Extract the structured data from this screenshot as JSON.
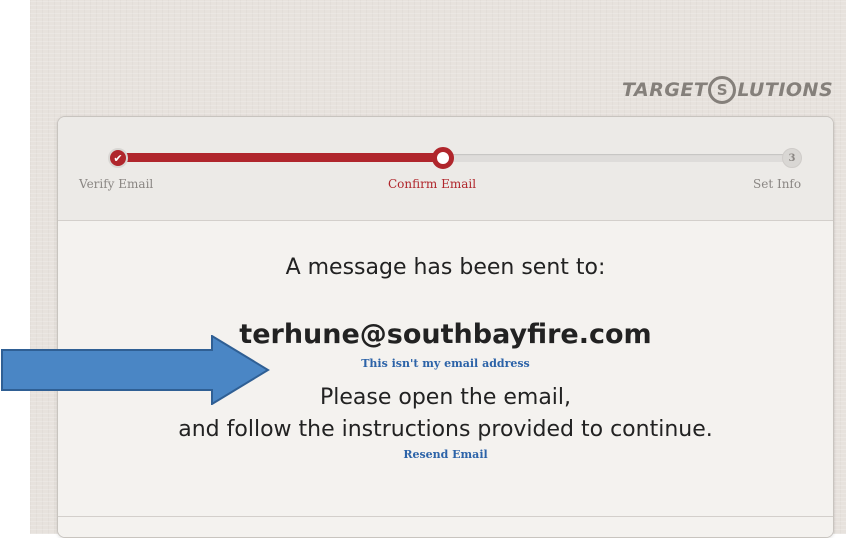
{
  "logo": {
    "pre": "TARGET",
    "s": "S",
    "post": "LUTIONS"
  },
  "steps": [
    {
      "label": "Verify Email",
      "marker": "✔",
      "state": "done"
    },
    {
      "label": "Confirm Email",
      "marker": "",
      "state": "current"
    },
    {
      "label": "Set Info",
      "marker": "3",
      "state": "upcoming"
    }
  ],
  "progress_fraction": 0.5,
  "content": {
    "line1": "A message has been sent to:",
    "email": "terhune@southbayfire.com",
    "not_my_email_link": "This isn't my email address",
    "line2": "Please open the email,",
    "line3": "and follow the instructions provided to continue.",
    "resend_link": "Resend Email"
  },
  "colors": {
    "accent": "#b0262c",
    "link": "#2c63a8",
    "arrow": "#4a86c5"
  },
  "annotation": {
    "icon": "arrow-right-icon"
  }
}
